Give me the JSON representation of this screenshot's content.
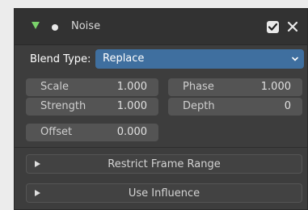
{
  "modifier": {
    "title": "Noise",
    "enabled": true,
    "expanded": true
  },
  "blend": {
    "label": "Blend Type:",
    "value": "Replace"
  },
  "fields": {
    "scale": {
      "label": "Scale",
      "value": "1.000"
    },
    "strength": {
      "label": "Strength",
      "value": "1.000"
    },
    "offset": {
      "label": "Offset",
      "value": "0.000"
    },
    "phase": {
      "label": "Phase",
      "value": "1.000"
    },
    "depth": {
      "label": "Depth",
      "value": "0"
    }
  },
  "subpanels": {
    "restrict_frame_range": "Restrict Frame Range",
    "use_influence": "Use Influence"
  },
  "colors": {
    "panel_bg": "#3d3d3d",
    "accent_select": "#3f6f9f",
    "expand_arrow": "#7ad26a",
    "field_bg": "#545454"
  },
  "icons": [
    "expand-arrow-icon",
    "dot-icon",
    "checkbox-icon",
    "close-icon",
    "chevron-down-icon",
    "triangle-right-icon"
  ]
}
